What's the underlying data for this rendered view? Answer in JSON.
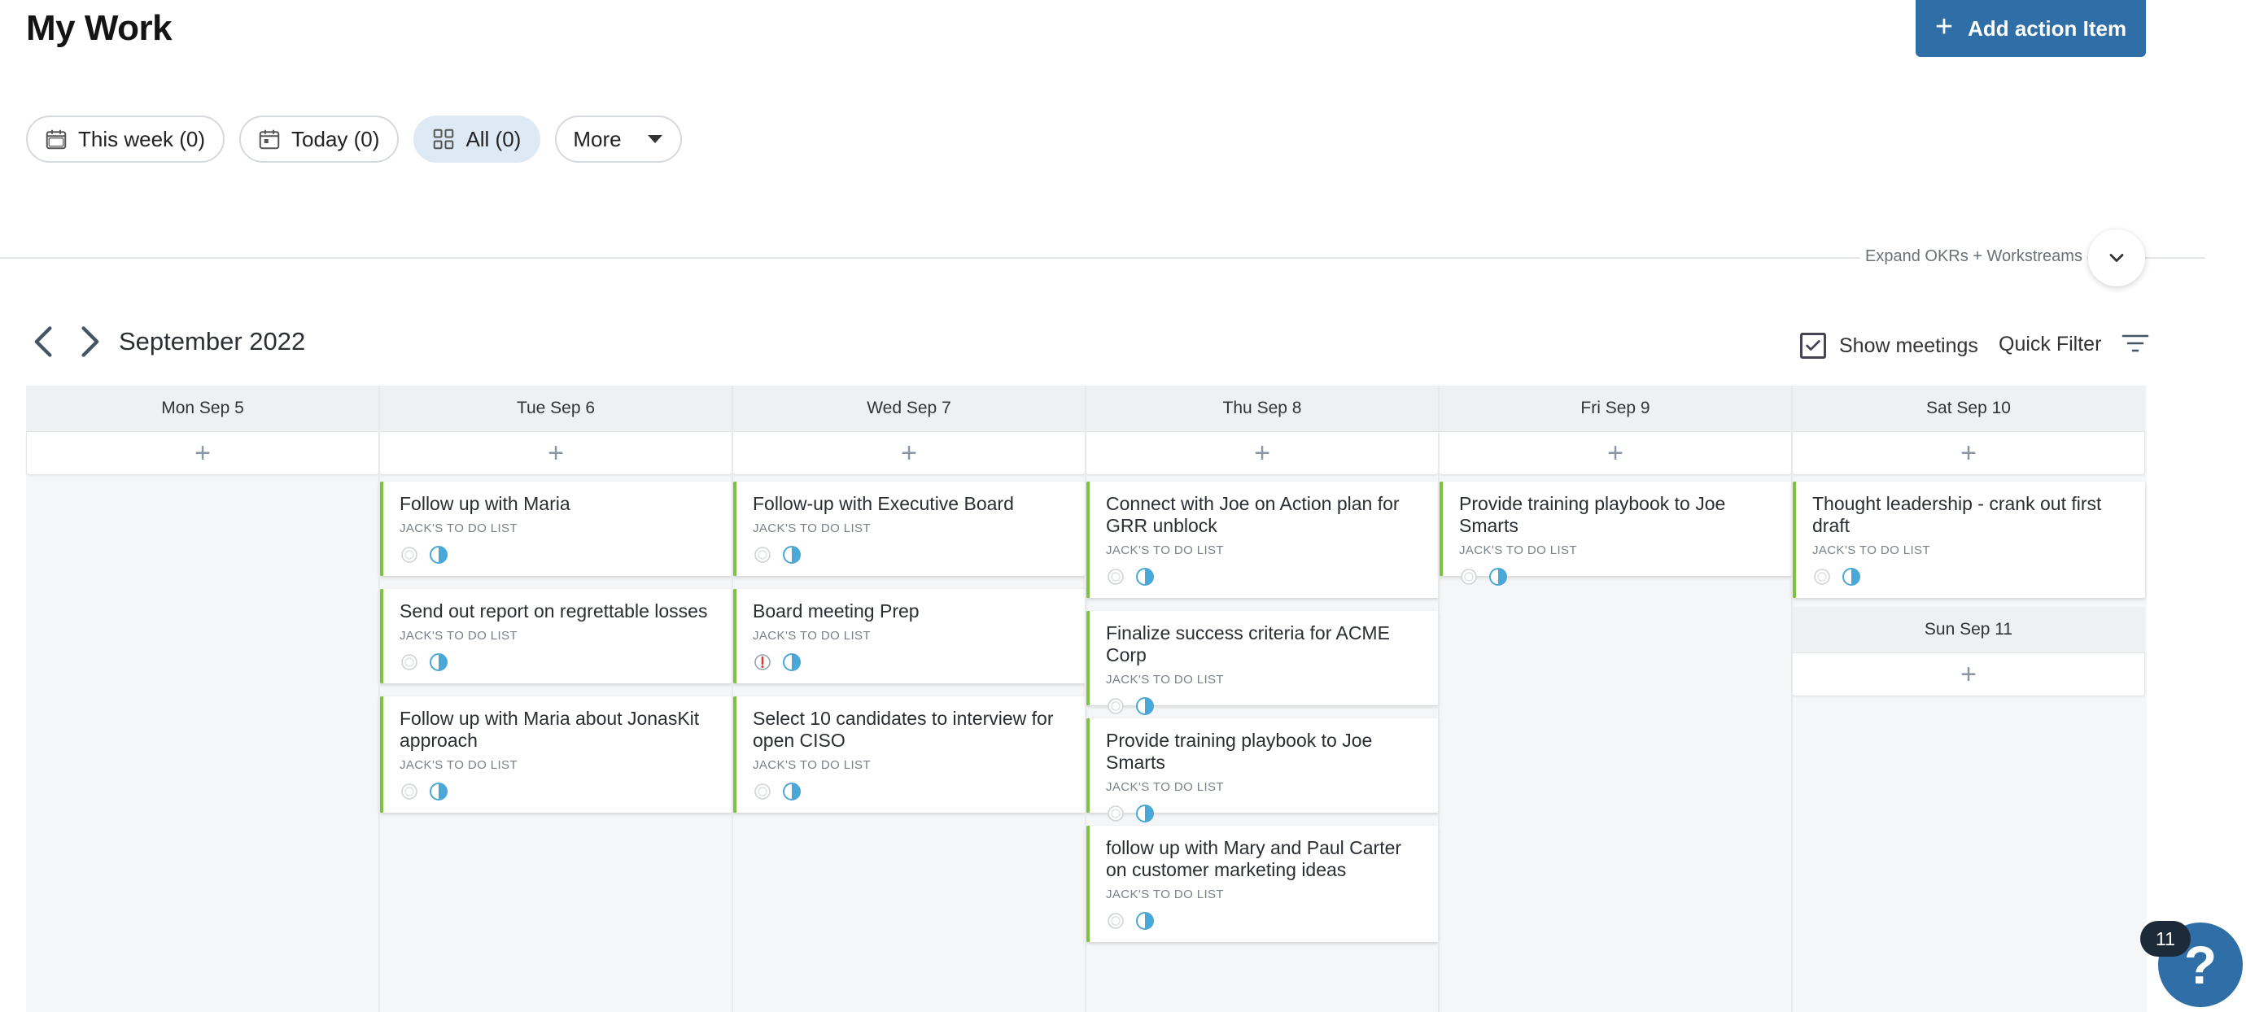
{
  "header": {
    "title": "My Work",
    "add_button_label": "Add action Item"
  },
  "filters": [
    {
      "label": "This week (0)",
      "icon": "calendar-week-icon"
    },
    {
      "label": "Today (0)",
      "icon": "calendar-day-icon"
    },
    {
      "label": "All (0)",
      "icon": "grid-icon",
      "active": true
    },
    {
      "label": "More",
      "icon": "caret-down-icon"
    }
  ],
  "expand_label": "Expand OKRs + Workstreams",
  "calendar": {
    "month": "September 2022",
    "show_meetings_label": "Show meetings",
    "show_meetings_checked": true,
    "quick_filter_label": "Quick Filter",
    "add_symbol": "+",
    "days": [
      {
        "label": "Mon Sep 5",
        "items": []
      },
      {
        "label": "Tue Sep 6",
        "items": [
          {
            "title": "Follow up with Maria",
            "list": "JACK'S TO DO LIST",
            "alert": false
          },
          {
            "title": "Send out report on regrettable losses",
            "list": "JACK'S TO DO LIST",
            "alert": false
          },
          {
            "title": "Follow up with Maria about JonasKit approach",
            "list": "JACK'S TO DO LIST",
            "alert": false
          }
        ]
      },
      {
        "label": "Wed Sep 7",
        "items": [
          {
            "title": "Follow-up with Executive Board",
            "list": "JACK'S TO DO LIST",
            "alert": false
          },
          {
            "title": "Board meeting Prep",
            "list": "JACK'S TO DO LIST",
            "alert": true
          },
          {
            "title": "Select 10 candidates to interview for open CISO",
            "list": "JACK'S TO DO LIST",
            "alert": false
          }
        ]
      },
      {
        "label": "Thu Sep 8",
        "items": [
          {
            "title": "Connect with Joe on Action plan for GRR unblock",
            "list": "JACK'S TO DO LIST",
            "alert": false
          },
          {
            "title": "Finalize success criteria for ACME Corp",
            "list": "JACK'S TO DO LIST",
            "alert": false
          },
          {
            "title": "Provide training playbook to Joe Smarts",
            "list": "JACK'S TO DO LIST",
            "alert": false
          },
          {
            "title": "follow up with Mary and Paul Carter on customer marketing ideas",
            "list": "JACK'S TO DO LIST",
            "alert": false
          }
        ]
      },
      {
        "label": "Fri Sep 9",
        "items": [
          {
            "title": "Provide training playbook to Joe Smarts",
            "list": "JACK'S TO DO LIST",
            "alert": false
          }
        ]
      },
      {
        "label": "Sat Sep 10",
        "items": [
          {
            "title": "Thought leadership - crank out first draft",
            "list": "JACK'S TO DO LIST",
            "alert": false
          }
        ]
      }
    ],
    "sunday": {
      "label": "Sun Sep 11",
      "items": []
    }
  },
  "help": {
    "badge_count": "11",
    "symbol": "?"
  },
  "colors": {
    "primary": "#2f6ea6",
    "card_accent": "#7dc242",
    "progress": "#4aa8d8",
    "alert": "#d93a3a"
  }
}
